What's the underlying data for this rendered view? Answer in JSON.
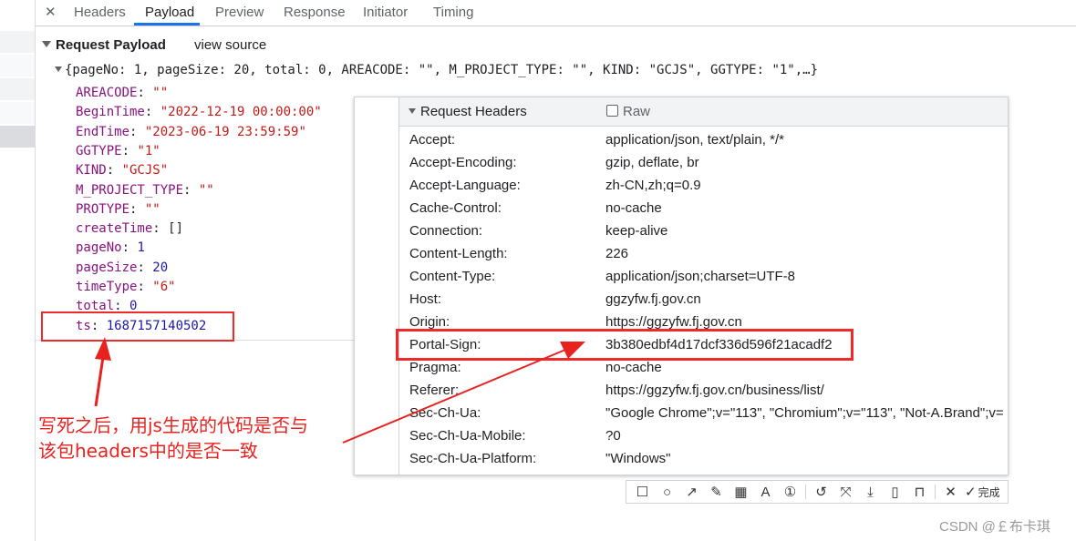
{
  "tabs": [
    {
      "label": "Headers"
    },
    {
      "label": "Payload"
    },
    {
      "label": "Preview"
    },
    {
      "label": "Response"
    },
    {
      "label": "Initiator"
    },
    {
      "label": "Timing"
    }
  ],
  "payload": {
    "title": "Request Payload",
    "view_source": "view source",
    "summary": "{pageNo: 1, pageSize: 20, total: 0, AREACODE: \"\", M_PROJECT_TYPE: \"\", KIND: \"GCJS\", GGTYPE: \"1\",…}",
    "fields": [
      {
        "key": "AREACODE",
        "value": "\"\"",
        "type": "s"
      },
      {
        "key": "BeginTime",
        "value": "\"2022-12-19 00:00:00\"",
        "type": "s"
      },
      {
        "key": "EndTime",
        "value": "\"2023-06-19 23:59:59\"",
        "type": "s"
      },
      {
        "key": "GGTYPE",
        "value": "\"1\"",
        "type": "s"
      },
      {
        "key": "KIND",
        "value": "\"GCJS\"",
        "type": "s"
      },
      {
        "key": "M_PROJECT_TYPE",
        "value": "\"\"",
        "type": "s"
      },
      {
        "key": "PROTYPE",
        "value": "\"\"",
        "type": "s"
      },
      {
        "key": "createTime",
        "value": "[]",
        "type": "p"
      },
      {
        "key": "pageNo",
        "value": "1",
        "type": "n"
      },
      {
        "key": "pageSize",
        "value": "20",
        "type": "n"
      },
      {
        "key": "timeType",
        "value": "\"6\"",
        "type": "s"
      },
      {
        "key": "total",
        "value": "0",
        "type": "n"
      },
      {
        "key": "ts",
        "value": "1687157140502",
        "type": "n"
      }
    ]
  },
  "headers_popup": {
    "title": "Request Headers",
    "raw_label": "Raw",
    "rows": [
      {
        "name": "Accept:",
        "value": "application/json, text/plain, */*"
      },
      {
        "name": "Accept-Encoding:",
        "value": "gzip, deflate, br"
      },
      {
        "name": "Accept-Language:",
        "value": "zh-CN,zh;q=0.9"
      },
      {
        "name": "Cache-Control:",
        "value": "no-cache"
      },
      {
        "name": "Connection:",
        "value": "keep-alive"
      },
      {
        "name": "Content-Length:",
        "value": "226"
      },
      {
        "name": "Content-Type:",
        "value": "application/json;charset=UTF-8"
      },
      {
        "name": "Host:",
        "value": "ggzyfw.fj.gov.cn"
      },
      {
        "name": "Origin:",
        "value": "https://ggzyfw.fj.gov.cn"
      },
      {
        "name": "Portal-Sign:",
        "value": "3b380edbf4d17dcf336d596f21acadf2"
      },
      {
        "name": "Pragma:",
        "value": "no-cache"
      },
      {
        "name": "Referer:",
        "value": "https://ggzyfw.fj.gov.cn/business/list/"
      },
      {
        "name": "Sec-Ch-Ua:",
        "value": "\"Google Chrome\";v=\"113\", \"Chromium\";v=\"113\", \"Not-A.Brand\";v="
      },
      {
        "name": "Sec-Ch-Ua-Mobile:",
        "value": "?0"
      },
      {
        "name": "Sec-Ch-Ua-Platform:",
        "value": "\"Windows\""
      }
    ]
  },
  "annotation": {
    "line1": "写死之后，用js生成的代码是否与",
    "line2": "该包headers中的是否一致",
    "color": "#e8231f"
  },
  "toolbar": {
    "done_label": "完成",
    "icons": [
      "rectangle-icon",
      "circle-icon",
      "arrow-icon",
      "pen-icon",
      "mosaic-icon",
      "text-icon",
      "number-icon",
      "undo-icon",
      "crop-icon",
      "download-icon",
      "pin-icon",
      "bookmark-icon",
      "close-icon",
      "check-icon"
    ]
  },
  "watermark": "CSDN @￡布卡琪"
}
